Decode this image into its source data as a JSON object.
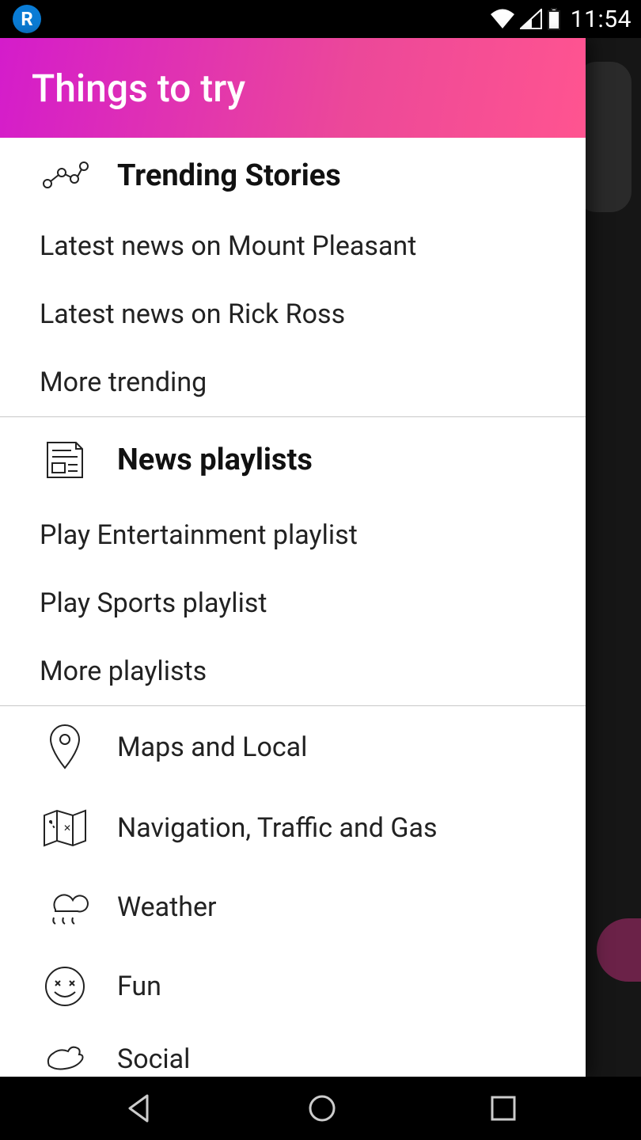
{
  "status": {
    "badge": "R",
    "clock": "11:54"
  },
  "drawer": {
    "title": "Things to try",
    "sections": [
      {
        "icon": "trend-icon",
        "title": "Trending Stories",
        "items": [
          {
            "label": "Latest news on Mount Pleasant"
          },
          {
            "label": "Latest news on Rick Ross"
          },
          {
            "label": "More trending"
          }
        ]
      },
      {
        "icon": "newspaper-icon",
        "title": "News playlists",
        "items": [
          {
            "label": "Play Entertainment playlist"
          },
          {
            "label": "Play Sports playlist"
          },
          {
            "label": "More playlists"
          }
        ]
      }
    ],
    "categories": [
      {
        "icon": "pin-icon",
        "label": "Maps and Local"
      },
      {
        "icon": "map-icon",
        "label": "Navigation, Traffic and Gas"
      },
      {
        "icon": "rain-icon",
        "label": "Weather"
      },
      {
        "icon": "smile-icon",
        "label": "Fun"
      },
      {
        "icon": "bird-icon",
        "label": "Social"
      }
    ]
  }
}
